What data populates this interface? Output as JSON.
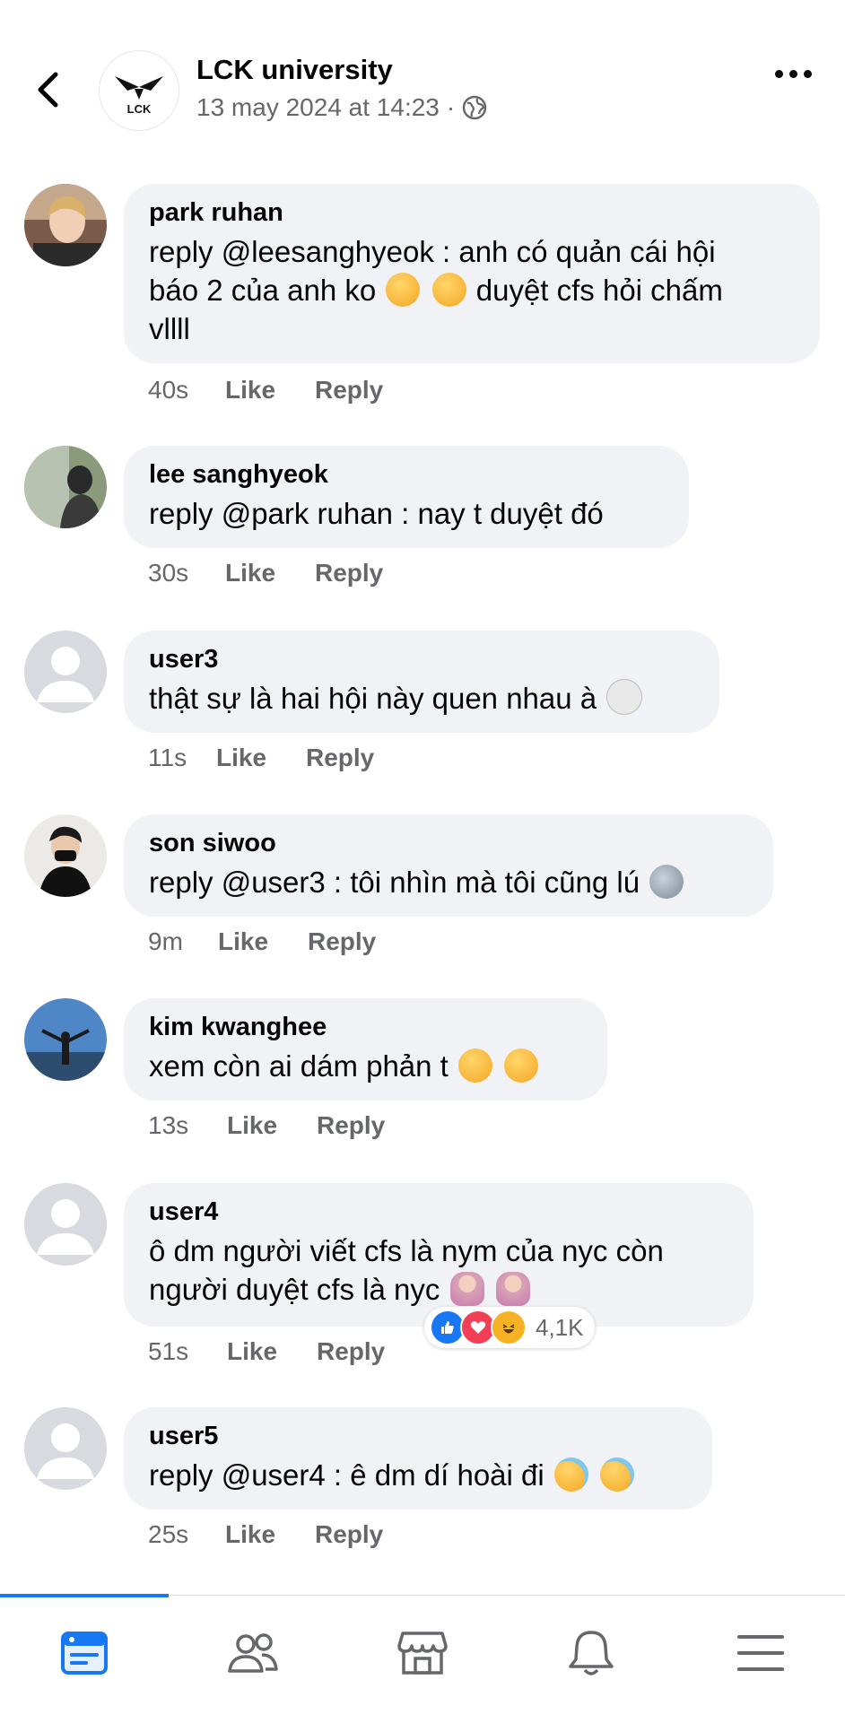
{
  "header": {
    "page_name": "LCK university",
    "timestamp": "13 may 2024 at 14:23",
    "separator": "·",
    "logo_text": "LCK",
    "privacy_icon": "globe-icon"
  },
  "comments": [
    {
      "author": "park ruhan",
      "text_lines": [
        "reply @leesanghyeok : anh có quản cái hội",
        "báo 2 của anh ko",
        "duyệt cfs hỏi chấm",
        "vllll"
      ],
      "time": "40s",
      "like": "Like",
      "reply": "Reply",
      "avatar": "photo-avatar"
    },
    {
      "author": "lee sanghyeok",
      "text": "reply @park ruhan : nay t duyệt đó",
      "time": "30s",
      "like": "Like",
      "reply": "Reply",
      "avatar": "photo-avatar"
    },
    {
      "author": "user3",
      "text": "thật sự là hai hội này quen nhau à",
      "time": "11s",
      "like": "Like",
      "reply": "Reply",
      "avatar": "default-avatar"
    },
    {
      "author": "son siwoo",
      "text": "reply @user3 : tôi nhìn mà tôi cũng lú",
      "time": "9m",
      "like": "Like",
      "reply": "Reply",
      "avatar": "photo-avatar"
    },
    {
      "author": "kim kwanghee",
      "text": "xem còn ai dám phản t",
      "time": "13s",
      "like": "Like",
      "reply": "Reply",
      "avatar": "photo-avatar"
    },
    {
      "author": "user4",
      "text_lines": [
        "ô dm người viết cfs là nym của nyc còn",
        "người duyệt cfs là nyc"
      ],
      "time": "51s",
      "like": "Like",
      "reply": "Reply",
      "avatar": "default-avatar",
      "reaction_count": "4,1K"
    },
    {
      "author": "user5",
      "text": "reply @user4 : ê dm dí hoài đi",
      "time": "25s",
      "like": "Like",
      "reply": "Reply",
      "avatar": "default-avatar"
    }
  ],
  "bottom_nav": [
    "feed-icon",
    "friends-icon",
    "marketplace-icon",
    "notifications-icon",
    "menu-icon"
  ],
  "colors": {
    "accent": "#1877f2",
    "bubble": "#f0f2f5",
    "secondary_text": "#65676b"
  }
}
